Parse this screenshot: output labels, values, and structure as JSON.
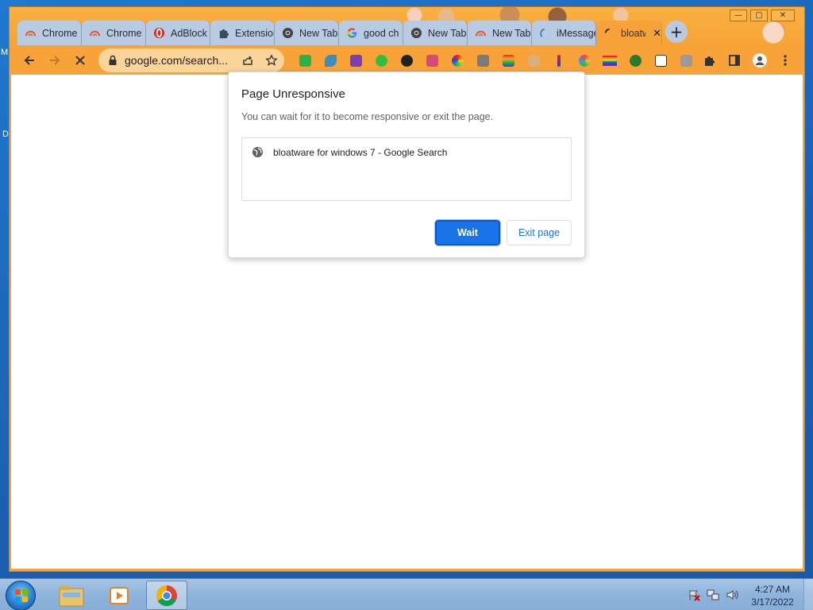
{
  "desktop": {
    "left_letters": [
      "M",
      "D"
    ]
  },
  "window": {
    "controls": {
      "minimize": "—",
      "maximize": "▢",
      "close": "✕"
    }
  },
  "tabs": [
    {
      "label": "Chrome",
      "icon": "rainbow-icon"
    },
    {
      "label": "Chrome",
      "icon": "rainbow-icon"
    },
    {
      "label": "AdBlock",
      "icon": "adblock-icon"
    },
    {
      "label": "Extensions",
      "icon": "puzzle-icon"
    },
    {
      "label": "New Tab",
      "icon": "chrome-icon"
    },
    {
      "label": "good ch",
      "icon": "google-icon"
    },
    {
      "label": "New Tab",
      "icon": "chrome-icon"
    },
    {
      "label": "New Tab",
      "icon": "rainbow-icon"
    },
    {
      "label": "iMessage",
      "icon": "imessage-icon"
    },
    {
      "label": "bloatware",
      "icon": "loading-icon",
      "active": true
    }
  ],
  "toolbar": {
    "omnibox_text": "google.com/search...",
    "extensions_colors": [
      "#2bb34a",
      "#3a8fbf",
      "#7a3fb0",
      "#2fbf3f",
      "#222222",
      "#d44a7a",
      "#e2a020",
      "#7a7a7a",
      "#c43a3a",
      "#e02020",
      "#d0a030",
      "#e0402a",
      "#2a7a2a",
      "#cc2244",
      "#888888",
      "#333333"
    ]
  },
  "dialog": {
    "title": "Page Unresponsive",
    "description": "You can wait for it to become responsive or exit the page.",
    "page_item": "bloatware for windows 7 - Google Search",
    "wait_label": "Wait",
    "exit_label": "Exit page"
  },
  "taskbar": {
    "time": "4:27 AM",
    "date": "3/17/2022"
  }
}
